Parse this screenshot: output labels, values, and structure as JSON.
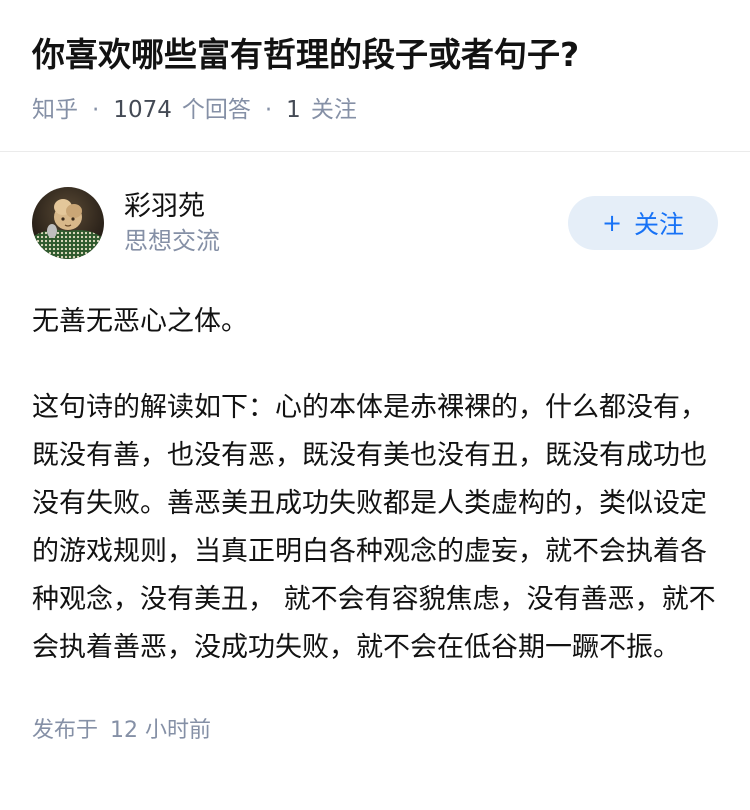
{
  "question": {
    "title": "你喜欢哪些富有哲理的段子或者句子?",
    "source": "知乎",
    "separator": "·",
    "answer_count": "1074",
    "answer_label": "个回答",
    "follow_count": "1",
    "follow_label": "关注"
  },
  "author": {
    "name": "彩羽苑",
    "bio": "思想交流",
    "follow_button": {
      "icon": "+",
      "label": "关注"
    }
  },
  "answer": {
    "paragraphs": [
      "无善无恶心之体。",
      "这句诗的解读如下：心的本体是赤裸裸的，什么都没有，既没有善，也没有恶，既没有美也没有丑，既没有成功也没有失败。善恶美丑成功失败都是人类虚构的，类似设定的游戏规则，当真正明白各种观念的虚妄，就不会执着各种观念，没有美丑， 就不会有容貌焦虑，没有善恶，就不会执着善恶，没成功失败，就不会在低谷期一蹶不振。"
    ]
  },
  "footer": {
    "published_label": "发布于",
    "time": "12 小时前"
  },
  "colors": {
    "accent": "#1772f6",
    "accent_bg": "#e5eef8",
    "meta": "#8590a6",
    "text": "#121212"
  }
}
